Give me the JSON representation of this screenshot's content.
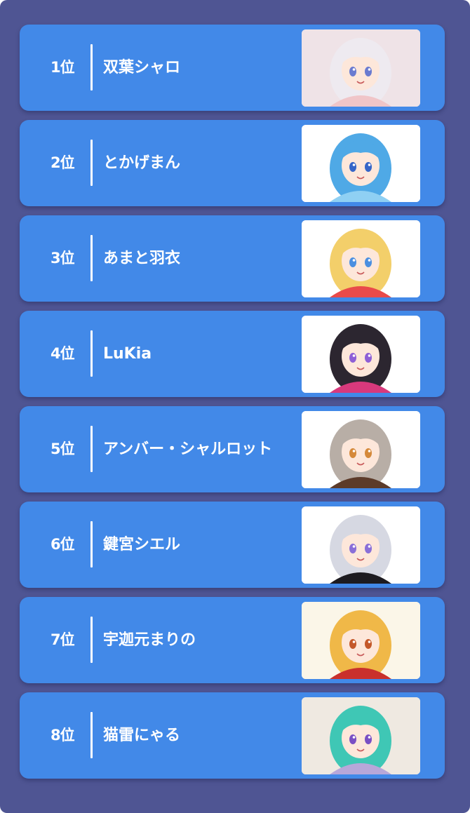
{
  "ranking": {
    "items": [
      {
        "rank": "1位",
        "name": "双葉シャロ",
        "image": "vtuber-avatar-image",
        "hair": "#eeeaf0",
        "bg": "#efe3e7",
        "eye": "#6a7bd0",
        "accent": "#f0c5c8"
      },
      {
        "rank": "2位",
        "name": "とかげまん",
        "image": "vtuber-avatar-image",
        "hair": "#4fa9e6",
        "bg": "#ffffff",
        "eye": "#3565c8",
        "accent": "#8fd0f3"
      },
      {
        "rank": "3位",
        "name": "あまと羽衣",
        "image": "vtuber-avatar-image",
        "hair": "#f3cf6a",
        "bg": "#ffffff",
        "eye": "#4b8fe0",
        "accent": "#e94a4a"
      },
      {
        "rank": "4位",
        "name": "LuKia",
        "image": "vtuber-avatar-image",
        "hair": "#2c2630",
        "bg": "#ffffff",
        "eye": "#8e5fd6",
        "accent": "#d8397c"
      },
      {
        "rank": "5位",
        "name": "アンバー・シャルロット",
        "image": "vtuber-avatar-image",
        "hair": "#b8aea6",
        "bg": "#ffffff",
        "eye": "#d5893a",
        "accent": "#5c3b2a"
      },
      {
        "rank": "6位",
        "name": "鍵宮シエル",
        "image": "vtuber-avatar-image",
        "hair": "#d6d8e2",
        "bg": "#ffffff",
        "eye": "#8a6fd8",
        "accent": "#1d1b20"
      },
      {
        "rank": "7位",
        "name": "宇迦元まりの",
        "image": "vtuber-avatar-image",
        "hair": "#f0b848",
        "bg": "#fbf6e8",
        "eye": "#c4582a",
        "accent": "#c9302c"
      },
      {
        "rank": "8位",
        "name": "猫雷にゃる",
        "image": "vtuber-avatar-image",
        "hair": "#3fc7b5",
        "bg": "#efe9e1",
        "eye": "#7a4fc4",
        "accent": "#b7a7d9"
      }
    ]
  }
}
